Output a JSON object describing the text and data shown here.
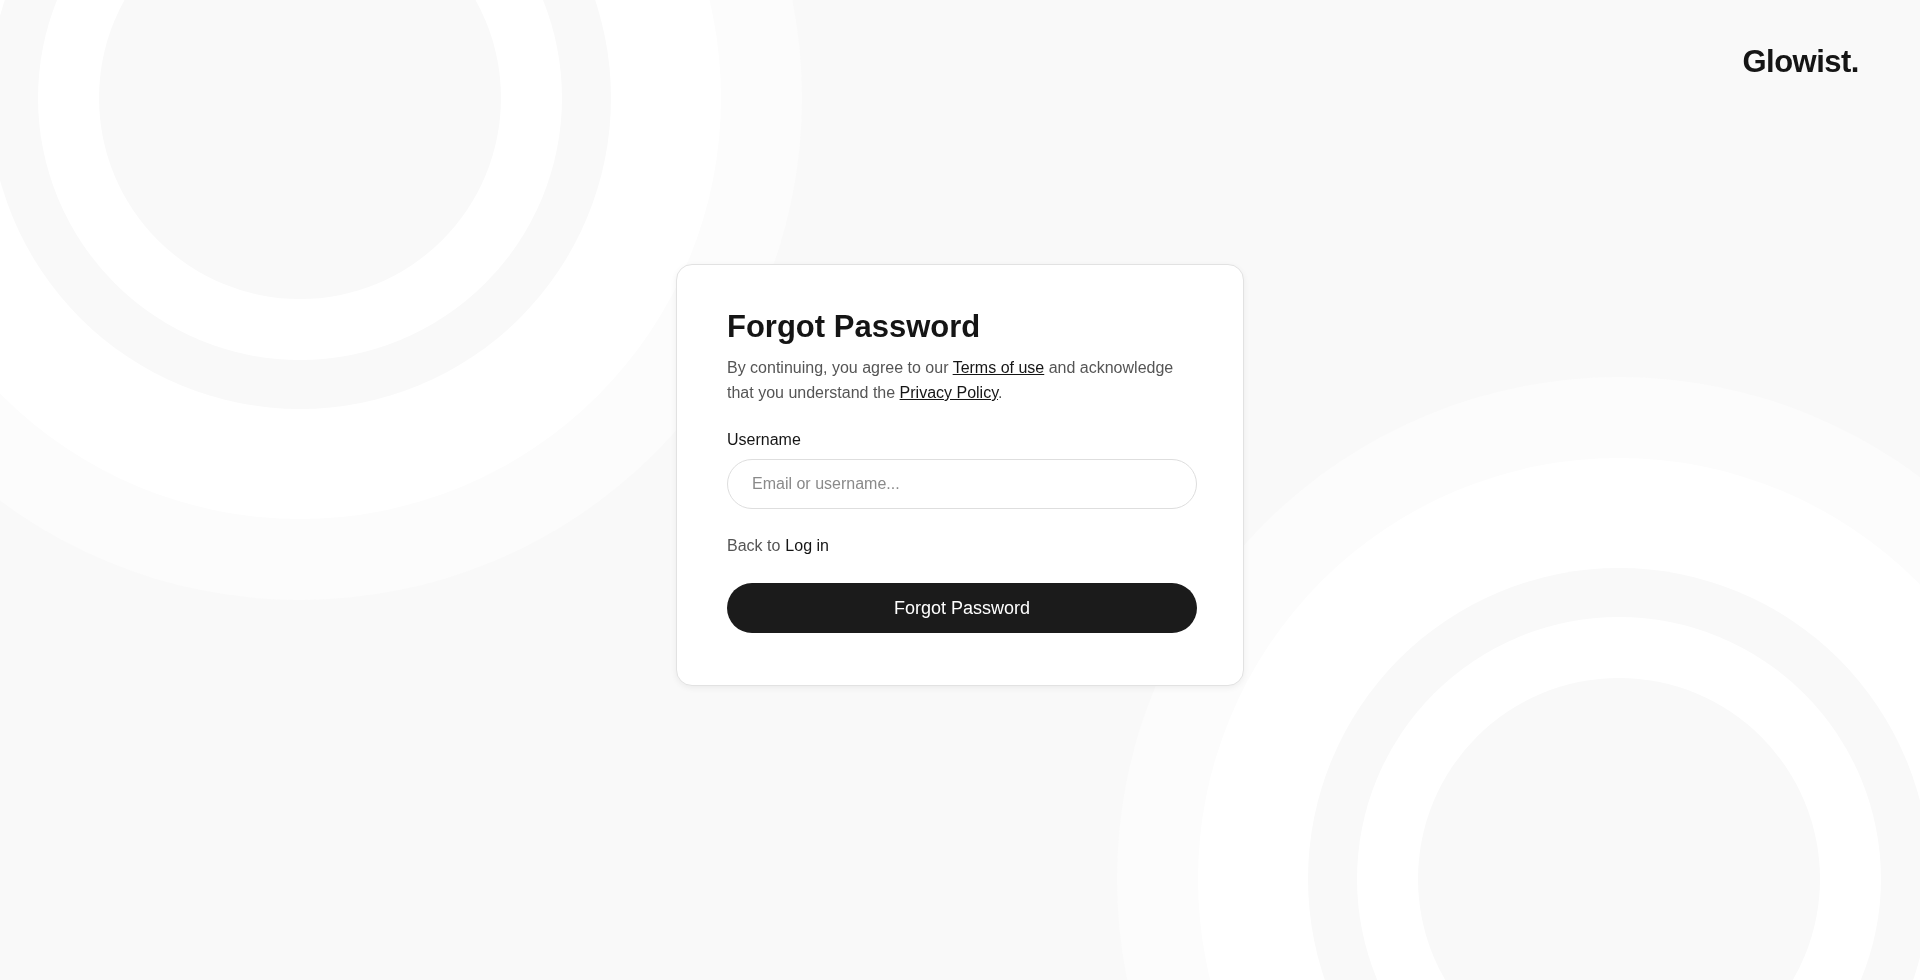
{
  "logo": "Glowist.",
  "form": {
    "title": "Forgot Password",
    "consent": {
      "before": "By continuing, you agree to our ",
      "terms_link": "Terms of use",
      "middle": " and acknowledge that you understand the ",
      "privacy_link": "Privacy Policy",
      "after": "."
    },
    "username": {
      "label": "Username",
      "placeholder": "Email or username..."
    },
    "back": {
      "text": "Back to",
      "link": "Log in"
    },
    "submit": "Forgot Password"
  }
}
